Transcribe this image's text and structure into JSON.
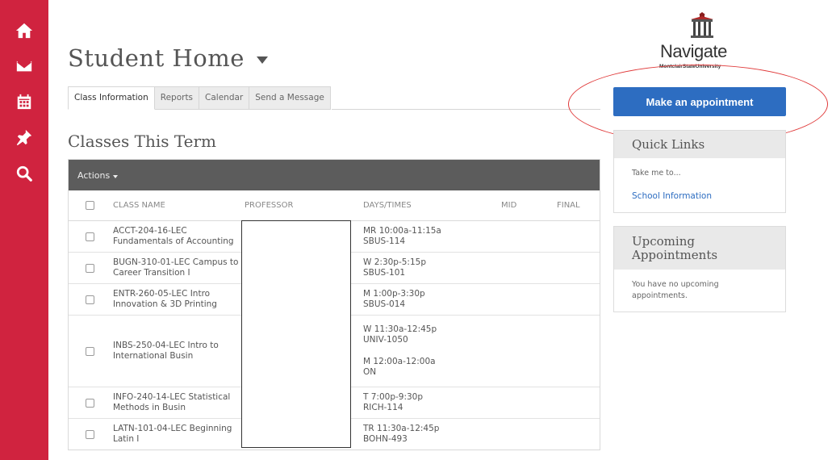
{
  "nav": {
    "items": [
      {
        "name": "home",
        "icon": "home-icon"
      },
      {
        "name": "messages",
        "icon": "envelope-icon"
      },
      {
        "name": "calendar",
        "icon": "calendar-icon"
      },
      {
        "name": "pin",
        "icon": "pushpin-icon"
      },
      {
        "name": "search",
        "icon": "search-icon"
      }
    ],
    "color": "#d0233f"
  },
  "header": {
    "title": "Student Home"
  },
  "tabs": [
    {
      "label": "Class Information",
      "active": true
    },
    {
      "label": "Reports",
      "active": false
    },
    {
      "label": "Calendar",
      "active": false
    },
    {
      "label": "Send a Message",
      "active": false
    }
  ],
  "classes": {
    "title": "Classes This Term",
    "actions_label": "Actions",
    "columns": [
      "CLASS NAME",
      "PROFESSOR",
      "DAYS/TIMES",
      "MID",
      "FINAL"
    ],
    "rows": [
      {
        "name": [
          "ACCT-204-16-LEC",
          "Fundamentals of Accounting"
        ],
        "days": [
          [
            "MR 10:00a-11:15a",
            "SBUS-114"
          ]
        ]
      },
      {
        "name": [
          "BUGN-310-01-LEC Campus to",
          "Career Transition I"
        ],
        "days": [
          [
            "W 2:30p-5:15p",
            "SBUS-101"
          ]
        ]
      },
      {
        "name": [
          "ENTR-260-05-LEC Intro",
          "Innovation & 3D Printing"
        ],
        "days": [
          [
            "M 1:00p-3:30p",
            "SBUS-014"
          ]
        ]
      },
      {
        "name": [
          "INBS-250-04-LEC Intro to",
          "International Busin"
        ],
        "days": [
          [
            "W 11:30a-12:45p",
            "UNIV-1050"
          ],
          [
            "M 12:00a-12:00a",
            "ON"
          ]
        ]
      },
      {
        "name": [
          "INFO-240-14-LEC Statistical",
          "Methods in Busin"
        ],
        "days": [
          [
            "T 7:00p-9:30p",
            "RICH-114"
          ]
        ]
      },
      {
        "name": [
          "LATN-101-04-LEC Beginning",
          "Latin I"
        ],
        "days": [
          [
            "TR 11:30a-12:45p",
            "BOHN-493"
          ]
        ]
      }
    ]
  },
  "sidebar": {
    "logo_word": "Navigate",
    "logo_sub": "MontclairStateUniversity",
    "appointment_button": "Make an appointment",
    "accent": "#2d6dc1",
    "quick_links": {
      "title": "Quick Links",
      "prompt": "Take me to...",
      "link": "School Information"
    },
    "upcoming": {
      "title": "Upcoming Appointments",
      "empty_text": "You have no upcoming appointments."
    }
  }
}
